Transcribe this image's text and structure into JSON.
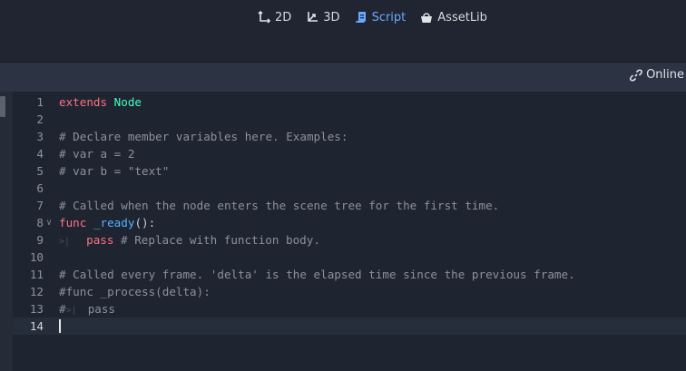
{
  "workspaces": [
    {
      "label": "2D",
      "icon": "2d-icon"
    },
    {
      "label": "3D",
      "icon": "3d-icon"
    },
    {
      "label": "Script",
      "icon": "script-icon",
      "active": true
    },
    {
      "label": "AssetLib",
      "icon": "assetlib-icon"
    }
  ],
  "toolbar": {
    "online_label": "Online",
    "online_icon": "link-icon"
  },
  "editor": {
    "current_line": 14,
    "lines": [
      {
        "num": "1",
        "segments": [
          {
            "t": "extends",
            "c": "kw"
          },
          {
            "t": " ",
            "c": ""
          },
          {
            "t": "Node",
            "c": "cls"
          }
        ]
      },
      {
        "num": "2",
        "segments": []
      },
      {
        "num": "3",
        "segments": [
          {
            "t": "# Declare member variables here. Examples:",
            "c": "cm"
          }
        ]
      },
      {
        "num": "4",
        "segments": [
          {
            "t": "# var a = 2",
            "c": "cm"
          }
        ]
      },
      {
        "num": "5",
        "segments": [
          {
            "t": "# var b = \"text\"",
            "c": "cm"
          }
        ]
      },
      {
        "num": "6",
        "segments": []
      },
      {
        "num": "7",
        "segments": [
          {
            "t": "# Called when the node enters the scene tree for the first time.",
            "c": "cm"
          }
        ]
      },
      {
        "num": "8",
        "fold": true,
        "segments": [
          {
            "t": "func",
            "c": "kw"
          },
          {
            "t": " ",
            "c": ""
          },
          {
            "t": "_ready",
            "c": "fn"
          },
          {
            "t": "():",
            "c": ""
          }
        ]
      },
      {
        "num": "9",
        "tab": true,
        "segments": [
          {
            "t": "pass",
            "c": "kw"
          },
          {
            "t": " # Replace with function body.",
            "c": "cm"
          }
        ]
      },
      {
        "num": "10",
        "segments": []
      },
      {
        "num": "11",
        "segments": [
          {
            "t": "# Called every frame. 'delta' is the elapsed time since the previous frame.",
            "c": "cm"
          }
        ]
      },
      {
        "num": "12",
        "segments": [
          {
            "t": "#func _process(delta):",
            "c": "cm"
          }
        ]
      },
      {
        "num": "13",
        "hashtab": true,
        "segments": [
          {
            "t": "pass",
            "c": "cm"
          }
        ]
      },
      {
        "num": "14",
        "segments": []
      }
    ]
  }
}
